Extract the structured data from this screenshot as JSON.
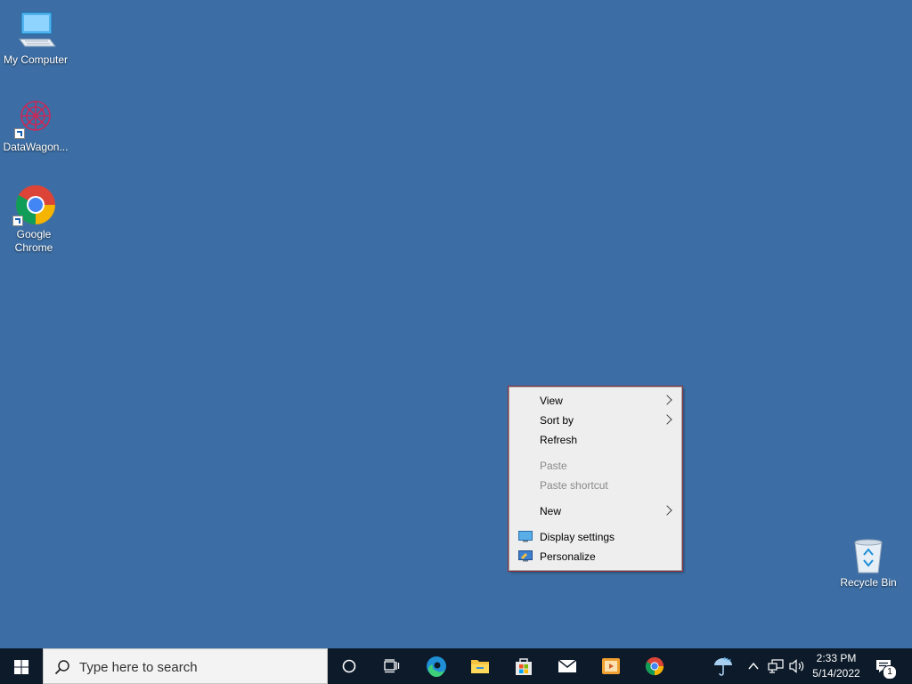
{
  "desktop": {
    "icons": [
      {
        "label": "My Computer"
      },
      {
        "label": "DataWagon..."
      },
      {
        "label": "Google Chrome"
      },
      {
        "label": "Recycle Bin"
      }
    ]
  },
  "context_menu": {
    "items": [
      {
        "label": "View",
        "submenu": true
      },
      {
        "label": "Sort by",
        "submenu": true
      },
      {
        "label": "Refresh"
      },
      {
        "label": "Paste",
        "disabled": true
      },
      {
        "label": "Paste shortcut",
        "disabled": true
      },
      {
        "label": "New",
        "submenu": true
      },
      {
        "label": "Display settings",
        "icon": "display-icon"
      },
      {
        "label": "Personalize",
        "icon": "personalize-icon"
      }
    ]
  },
  "taskbar": {
    "search_placeholder": "Type here to search",
    "pinned": [
      "cortana-icon",
      "task-view-icon",
      "edge-icon",
      "file-explorer-icon",
      "store-icon",
      "mail-icon",
      "media-player-icon",
      "chrome-icon"
    ],
    "tray": [
      "weather-icon",
      "chevron-up-icon",
      "network-icon",
      "volume-icon"
    ],
    "time": "2:33 PM",
    "date": "5/14/2022",
    "notification_count": "1"
  },
  "colors": {
    "desktop_bg": "#3c6ea5",
    "taskbar_bg": "#0c1a2a",
    "menu_bg": "#eeeeee"
  }
}
